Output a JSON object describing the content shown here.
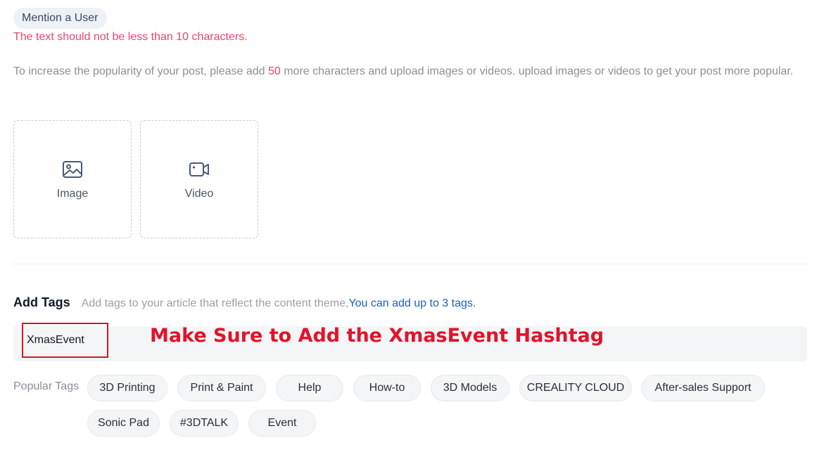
{
  "mention_button": "Mention a User",
  "error_message": "The text should not be less than 10 characters.",
  "hint": {
    "prefix": "To increase the popularity of your post, please add ",
    "count": "50",
    "suffix": " more characters and upload images or videos. upload images or videos to get your post more popular."
  },
  "upload": {
    "image_label": "Image",
    "video_label": "Video",
    "image_icon": "image-icon",
    "video_icon": "video-camera-icon"
  },
  "tags": {
    "title": "Add Tags",
    "description": "Add tags to your article that reflect the content theme,",
    "limit_text": " You can add up to 3 tags.",
    "current_value": "XmasEvent"
  },
  "annotation": "Make Sure to Add the XmasEvent Hashtag",
  "popular": {
    "label": "Popular Tags",
    "items": [
      "3D Printing",
      "Print & Paint",
      "Help",
      "How-to",
      "3D Models",
      "CREALITY CLOUD",
      "After-sales Support",
      "Sonic Pad",
      "#3DTALK",
      "Event"
    ]
  },
  "colors": {
    "error": "#e5476a",
    "link": "#1e5fb8",
    "annotation": "#e3122a",
    "annotation_box": "#d8161f"
  }
}
